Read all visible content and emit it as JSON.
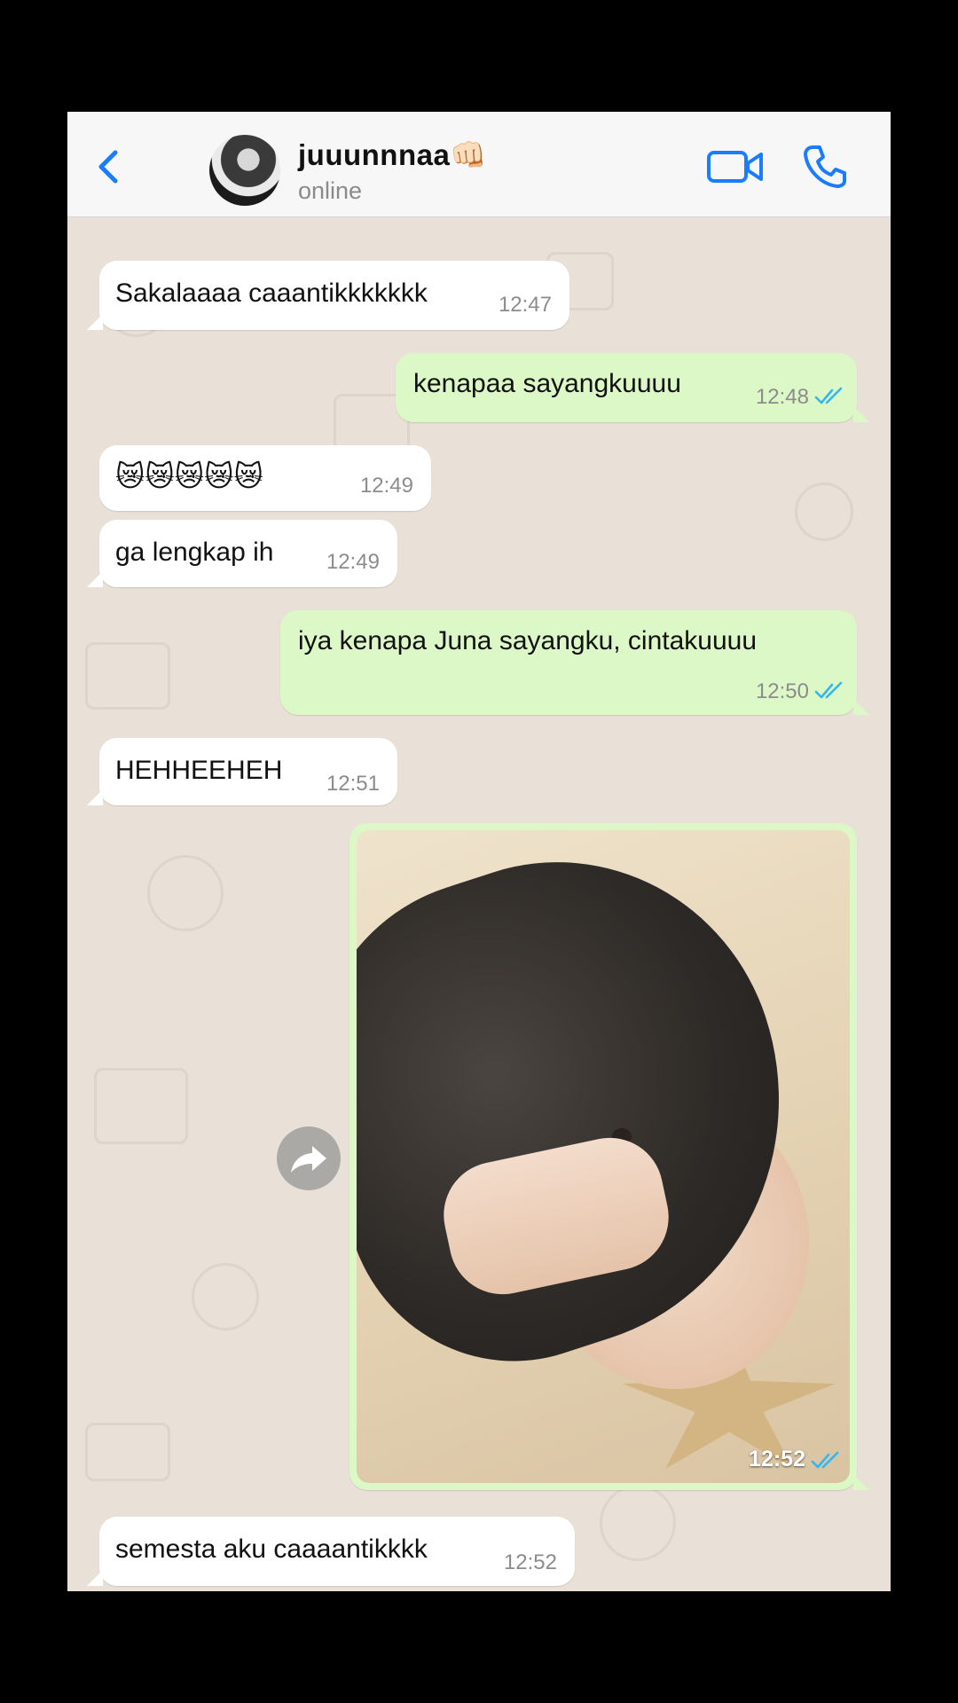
{
  "header": {
    "contact_name": "juuunnnaa👊🏻",
    "status": "online"
  },
  "messages": [
    {
      "direction": "incoming",
      "text": "Sakalaaaa caaantikkkkkkk",
      "time": "12:47"
    },
    {
      "direction": "outgoing",
      "text": "kenapaa sayangkuuuu",
      "time": "12:48",
      "read": true
    },
    {
      "direction": "incoming",
      "text": "😿😿😿😿😿",
      "time": "12:49"
    },
    {
      "direction": "incoming",
      "text": "ga lengkap ih",
      "time": "12:49"
    },
    {
      "direction": "outgoing",
      "text": "iya kenapa Juna sayangku, cintakuuuu",
      "time": "12:50",
      "read": true
    },
    {
      "direction": "incoming",
      "text": "HEHHEEHEH",
      "time": "12:51"
    },
    {
      "direction": "outgoing",
      "type": "photo",
      "time": "12:52",
      "read": true
    },
    {
      "direction": "incoming",
      "text": "semesta aku caaaantikkkk",
      "time": "12:52"
    }
  ],
  "colors": {
    "accent": "#1a7cff",
    "read_tick": "#34b7f1",
    "incoming_bubble": "#ffffff",
    "outgoing_bubble": "#dcf8c6",
    "chat_background": "#e9e1d7"
  },
  "icons": [
    "back-chevron-icon",
    "video-call-icon",
    "voice-call-icon",
    "forward-icon",
    "double-check-icon"
  ]
}
